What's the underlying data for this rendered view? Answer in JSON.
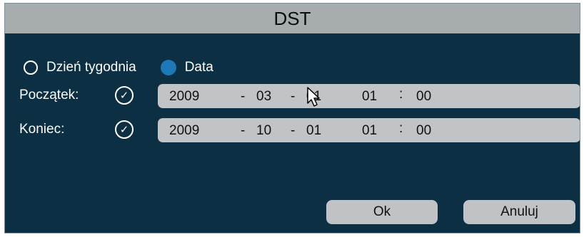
{
  "dialog": {
    "title": "DST"
  },
  "mode": {
    "options": [
      {
        "label": "Dzień tygodnia",
        "selected": false
      },
      {
        "label": "Data",
        "selected": true
      }
    ]
  },
  "start": {
    "label": "Początek:",
    "year": "2009",
    "month": "03",
    "day": "01",
    "hour": "01",
    "minute": "00",
    "sep_date": "-",
    "sep_time": ":"
  },
  "end": {
    "label": "Koniec:",
    "year": "2009",
    "month": "10",
    "day": "01",
    "hour": "01",
    "minute": "00",
    "sep_date": "-",
    "sep_time": ":"
  },
  "buttons": {
    "ok": "Ok",
    "cancel": "Anuluj"
  },
  "icons": {
    "radio": "radio-icon",
    "check": "check-circle-icon",
    "cursor": "mouse-pointer-icon"
  },
  "colors": {
    "background": "#0d2f43",
    "title_bar": "#a7acaf",
    "field": "#c0c4c7",
    "radio_selected": "#1d78b8"
  }
}
